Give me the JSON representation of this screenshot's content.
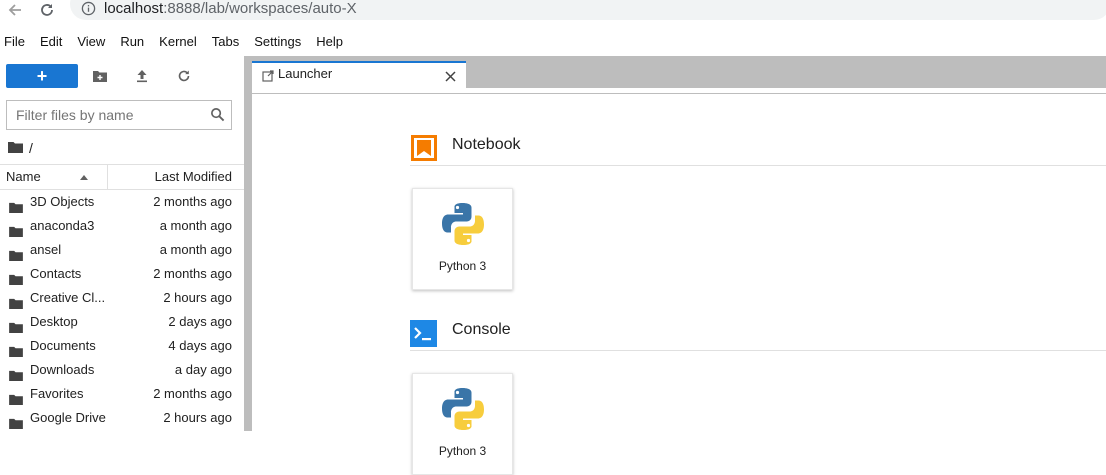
{
  "browser": {
    "url_host": "localhost",
    "url_path": ":8888/lab/workspaces/auto-X"
  },
  "menu": [
    "File",
    "Edit",
    "View",
    "Run",
    "Kernel",
    "Tabs",
    "Settings",
    "Help"
  ],
  "filebrowser": {
    "new_label": "+",
    "filter_placeholder": "Filter files by name",
    "breadcrumb": "/",
    "col_name": "Name",
    "col_modified": "Last Modified",
    "files": [
      {
        "name": "3D Objects",
        "modified": "2 months ago"
      },
      {
        "name": "anaconda3",
        "modified": "a month ago"
      },
      {
        "name": "ansel",
        "modified": "a month ago"
      },
      {
        "name": "Contacts",
        "modified": "2 months ago"
      },
      {
        "name": "Creative Cl...",
        "modified": "2 hours ago"
      },
      {
        "name": "Desktop",
        "modified": "2 days ago"
      },
      {
        "name": "Documents",
        "modified": "4 days ago"
      },
      {
        "name": "Downloads",
        "modified": "a day ago"
      },
      {
        "name": "Favorites",
        "modified": "2 months ago"
      },
      {
        "name": "Google Drive",
        "modified": "2 hours ago"
      }
    ]
  },
  "tab": {
    "label": "Launcher"
  },
  "launcher": {
    "notebook_title": "Notebook",
    "notebook_card": "Python 3",
    "console_title": "Console",
    "console_card": "Python 3"
  },
  "colors": {
    "accent": "#1976d2",
    "notebook_icon": "#f57c00",
    "console_icon": "#1e88e5"
  }
}
